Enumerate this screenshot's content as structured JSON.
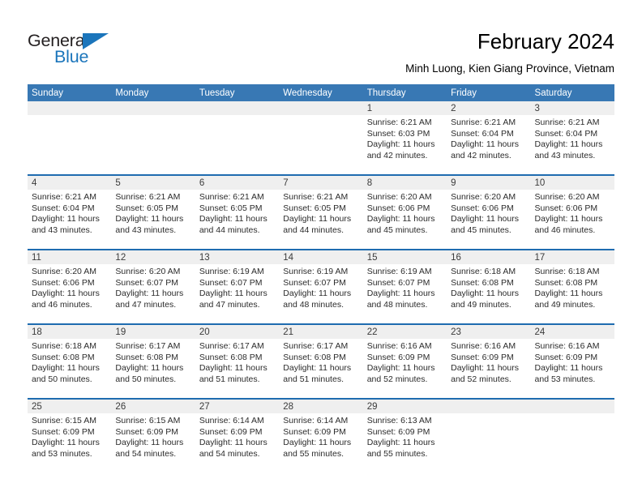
{
  "brand": {
    "name_top": "General",
    "name_bottom": "Blue",
    "accent_color": "#1b75bb"
  },
  "header": {
    "title": "February 2024",
    "subtitle": "Minh Luong, Kien Giang Province, Vietnam"
  },
  "calendar": {
    "header_color": "#3878b4",
    "separator_color": "#1f6cb0",
    "daynum_band_color": "#efefef",
    "weekdays": [
      "Sunday",
      "Monday",
      "Tuesday",
      "Wednesday",
      "Thursday",
      "Friday",
      "Saturday"
    ],
    "weeks": [
      [
        {
          "day": "",
          "lines": []
        },
        {
          "day": "",
          "lines": []
        },
        {
          "day": "",
          "lines": []
        },
        {
          "day": "",
          "lines": []
        },
        {
          "day": "1",
          "lines": [
            "Sunrise: 6:21 AM",
            "Sunset: 6:03 PM",
            "Daylight: 11 hours",
            "and 42 minutes."
          ]
        },
        {
          "day": "2",
          "lines": [
            "Sunrise: 6:21 AM",
            "Sunset: 6:04 PM",
            "Daylight: 11 hours",
            "and 42 minutes."
          ]
        },
        {
          "day": "3",
          "lines": [
            "Sunrise: 6:21 AM",
            "Sunset: 6:04 PM",
            "Daylight: 11 hours",
            "and 43 minutes."
          ]
        }
      ],
      [
        {
          "day": "4",
          "lines": [
            "Sunrise: 6:21 AM",
            "Sunset: 6:04 PM",
            "Daylight: 11 hours",
            "and 43 minutes."
          ]
        },
        {
          "day": "5",
          "lines": [
            "Sunrise: 6:21 AM",
            "Sunset: 6:05 PM",
            "Daylight: 11 hours",
            "and 43 minutes."
          ]
        },
        {
          "day": "6",
          "lines": [
            "Sunrise: 6:21 AM",
            "Sunset: 6:05 PM",
            "Daylight: 11 hours",
            "and 44 minutes."
          ]
        },
        {
          "day": "7",
          "lines": [
            "Sunrise: 6:21 AM",
            "Sunset: 6:05 PM",
            "Daylight: 11 hours",
            "and 44 minutes."
          ]
        },
        {
          "day": "8",
          "lines": [
            "Sunrise: 6:20 AM",
            "Sunset: 6:06 PM",
            "Daylight: 11 hours",
            "and 45 minutes."
          ]
        },
        {
          "day": "9",
          "lines": [
            "Sunrise: 6:20 AM",
            "Sunset: 6:06 PM",
            "Daylight: 11 hours",
            "and 45 minutes."
          ]
        },
        {
          "day": "10",
          "lines": [
            "Sunrise: 6:20 AM",
            "Sunset: 6:06 PM",
            "Daylight: 11 hours",
            "and 46 minutes."
          ]
        }
      ],
      [
        {
          "day": "11",
          "lines": [
            "Sunrise: 6:20 AM",
            "Sunset: 6:06 PM",
            "Daylight: 11 hours",
            "and 46 minutes."
          ]
        },
        {
          "day": "12",
          "lines": [
            "Sunrise: 6:20 AM",
            "Sunset: 6:07 PM",
            "Daylight: 11 hours",
            "and 47 minutes."
          ]
        },
        {
          "day": "13",
          "lines": [
            "Sunrise: 6:19 AM",
            "Sunset: 6:07 PM",
            "Daylight: 11 hours",
            "and 47 minutes."
          ]
        },
        {
          "day": "14",
          "lines": [
            "Sunrise: 6:19 AM",
            "Sunset: 6:07 PM",
            "Daylight: 11 hours",
            "and 48 minutes."
          ]
        },
        {
          "day": "15",
          "lines": [
            "Sunrise: 6:19 AM",
            "Sunset: 6:07 PM",
            "Daylight: 11 hours",
            "and 48 minutes."
          ]
        },
        {
          "day": "16",
          "lines": [
            "Sunrise: 6:18 AM",
            "Sunset: 6:08 PM",
            "Daylight: 11 hours",
            "and 49 minutes."
          ]
        },
        {
          "day": "17",
          "lines": [
            "Sunrise: 6:18 AM",
            "Sunset: 6:08 PM",
            "Daylight: 11 hours",
            "and 49 minutes."
          ]
        }
      ],
      [
        {
          "day": "18",
          "lines": [
            "Sunrise: 6:18 AM",
            "Sunset: 6:08 PM",
            "Daylight: 11 hours",
            "and 50 minutes."
          ]
        },
        {
          "day": "19",
          "lines": [
            "Sunrise: 6:17 AM",
            "Sunset: 6:08 PM",
            "Daylight: 11 hours",
            "and 50 minutes."
          ]
        },
        {
          "day": "20",
          "lines": [
            "Sunrise: 6:17 AM",
            "Sunset: 6:08 PM",
            "Daylight: 11 hours",
            "and 51 minutes."
          ]
        },
        {
          "day": "21",
          "lines": [
            "Sunrise: 6:17 AM",
            "Sunset: 6:08 PM",
            "Daylight: 11 hours",
            "and 51 minutes."
          ]
        },
        {
          "day": "22",
          "lines": [
            "Sunrise: 6:16 AM",
            "Sunset: 6:09 PM",
            "Daylight: 11 hours",
            "and 52 minutes."
          ]
        },
        {
          "day": "23",
          "lines": [
            "Sunrise: 6:16 AM",
            "Sunset: 6:09 PM",
            "Daylight: 11 hours",
            "and 52 minutes."
          ]
        },
        {
          "day": "24",
          "lines": [
            "Sunrise: 6:16 AM",
            "Sunset: 6:09 PM",
            "Daylight: 11 hours",
            "and 53 minutes."
          ]
        }
      ],
      [
        {
          "day": "25",
          "lines": [
            "Sunrise: 6:15 AM",
            "Sunset: 6:09 PM",
            "Daylight: 11 hours",
            "and 53 minutes."
          ]
        },
        {
          "day": "26",
          "lines": [
            "Sunrise: 6:15 AM",
            "Sunset: 6:09 PM",
            "Daylight: 11 hours",
            "and 54 minutes."
          ]
        },
        {
          "day": "27",
          "lines": [
            "Sunrise: 6:14 AM",
            "Sunset: 6:09 PM",
            "Daylight: 11 hours",
            "and 54 minutes."
          ]
        },
        {
          "day": "28",
          "lines": [
            "Sunrise: 6:14 AM",
            "Sunset: 6:09 PM",
            "Daylight: 11 hours",
            "and 55 minutes."
          ]
        },
        {
          "day": "29",
          "lines": [
            "Sunrise: 6:13 AM",
            "Sunset: 6:09 PM",
            "Daylight: 11 hours",
            "and 55 minutes."
          ]
        },
        {
          "day": "",
          "lines": []
        },
        {
          "day": "",
          "lines": []
        }
      ]
    ]
  }
}
